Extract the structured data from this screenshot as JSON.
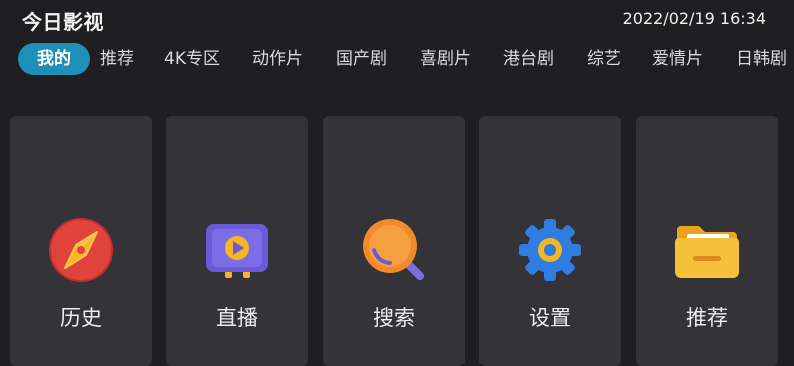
{
  "header": {
    "app_title": "今日影视",
    "datetime": "2022/02/19 16:34"
  },
  "tabs": [
    {
      "label": "我的",
      "active": true
    },
    {
      "label": "推荐"
    },
    {
      "label": "4K专区"
    },
    {
      "label": "动作片"
    },
    {
      "label": "国产剧"
    },
    {
      "label": "喜剧片"
    },
    {
      "label": "港台剧"
    },
    {
      "label": "综艺"
    },
    {
      "label": "爱情片"
    },
    {
      "label": "日韩剧"
    }
  ],
  "cards": [
    {
      "label": "历史",
      "icon": "compass-icon"
    },
    {
      "label": "直播",
      "icon": "tv-play-icon"
    },
    {
      "label": "搜索",
      "icon": "search-icon"
    },
    {
      "label": "设置",
      "icon": "gear-icon"
    },
    {
      "label": "推荐",
      "icon": "folder-icon"
    }
  ],
  "colors": {
    "background": "#1f1f21",
    "card": "#333338",
    "accent": "#1e8fb8"
  }
}
